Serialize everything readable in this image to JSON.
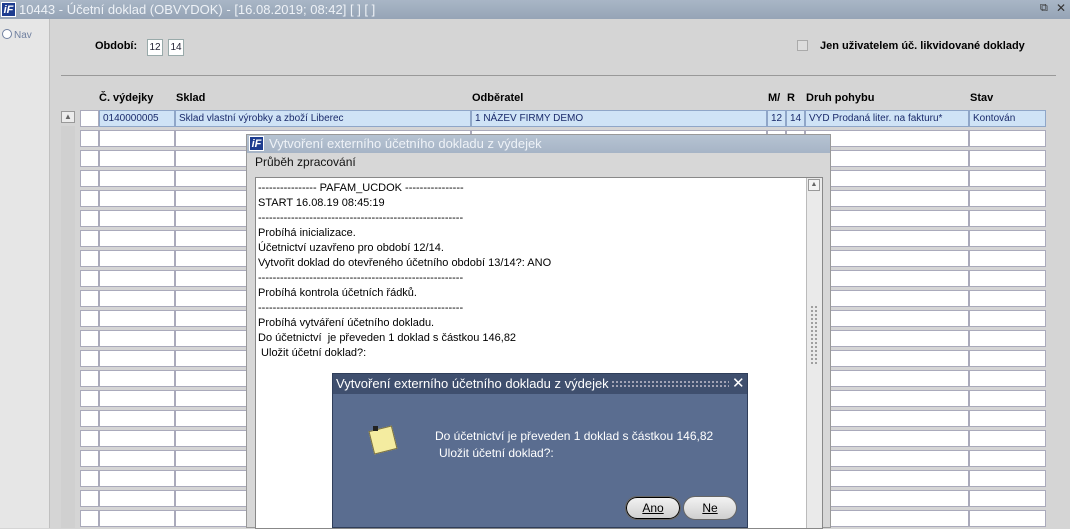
{
  "window": {
    "title": "10443 - Účetní doklad (OBVYDOK) - [16.08.2019; 08:42]  [ ]  [ ]",
    "logo": "iF",
    "restore_icon": "restore-window-icon",
    "close_icon": "close-icon"
  },
  "nav": {
    "label": "Nav"
  },
  "header": {
    "period_label": "Období:",
    "period_month": "12",
    "period_year": "14",
    "only_user_label": "Jen uživatelem úč. likvidované doklady",
    "only_user_checked": false
  },
  "table": {
    "columns": {
      "cislo": "Č. výdejky",
      "sklad": "Sklad",
      "odberatel": "Odběratel",
      "m": "M/",
      "r": "R",
      "druh": "Druh pohybu",
      "stav": "Stav"
    },
    "rows": [
      {
        "cislo": "0140000005",
        "sklad": "Sklad vlastní výrobky a zboží Liberec",
        "odberatel": "1 NÁZEV FIRMY DEMO",
        "m": "12",
        "r": "14",
        "druh": "VYD Prodaná liter. na fakturu*",
        "stav": "Kontován"
      }
    ]
  },
  "process_window": {
    "title": "Vytvoření externího účetního dokladu z výdejek",
    "subtitle": "Průběh zpracování",
    "log": "---------------- PAFAM_UCDOK ----------------\nSTART 16.08.19 08:45:19\n--------------------------------------------------------\nProbíhá inicializace.\nÚčetnictví uzavřeno pro období 12/14.\nVytvořit doklad do otevřeného účetního období 13/14?: ANO\n--------------------------------------------------------\nProbíhá kontrola účetních řádků.\n--------------------------------------------------------\nProbíhá vytváření účetního dokladu.\nDo účetnictví  je převeden 1 doklad s částkou 146,82\n Uložit účetní doklad?:"
  },
  "dialog": {
    "title": "Vytvoření externího účetního dokladu z výdejek",
    "message_line1": "Do účetnictví  je převeden 1 doklad s částkou 146,82",
    "message_line2": "Uložit účetní doklad?:",
    "icon": "note-icon",
    "yes_label": "Ano",
    "no_label": "Ne",
    "close_symbol": "✕"
  }
}
